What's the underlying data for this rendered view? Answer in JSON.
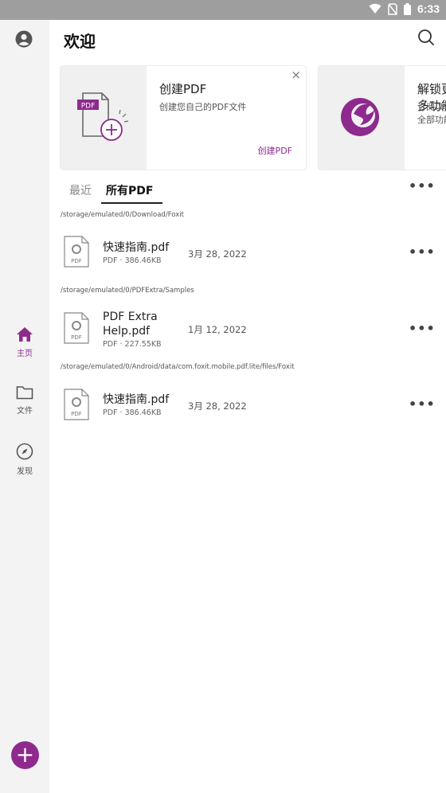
{
  "status_bar": {
    "time": "6:33"
  },
  "header": {
    "title": "欢迎"
  },
  "promo_cards": [
    {
      "title": "创建PDF",
      "description": "创建您自己的PDF文件",
      "action": "创建PDF",
      "icon_badge": "PDF",
      "close": "×"
    },
    {
      "title": "解锁更多功能",
      "description": "订阅以使用全部功能"
    }
  ],
  "tabs": [
    {
      "label": "最近"
    },
    {
      "label": "所有PDF"
    }
  ],
  "more_label": "•••",
  "files": [
    {
      "path": "/storage/emulated/0/Download/Foxit",
      "name": "快速指南.pdf",
      "type": "PDF",
      "size": "386.46KB",
      "date": "3月 28, 2022",
      "badge": "PDF"
    },
    {
      "path": "/storage/emulated/0/PDFExtra/Samples",
      "name_line1": "PDF Extra",
      "name_line2": "Help.pdf",
      "type": "PDF",
      "size": "227.55KB",
      "date": "1月 12, 2022",
      "badge": "PDF"
    },
    {
      "path": "/storage/emulated/0/Android/data/com.foxit.mobile.pdf.lite/files/Foxit",
      "name": "快速指南.pdf",
      "type": "PDF",
      "size": "386.46KB",
      "date": "3月 28, 2022",
      "badge": "PDF"
    }
  ],
  "nav": [
    {
      "label": "主页",
      "icon": "home-icon"
    },
    {
      "label": "文件",
      "icon": "folder-icon"
    },
    {
      "label": "发现",
      "icon": "compass-icon"
    }
  ],
  "fab": {
    "label": "+"
  },
  "colors": {
    "accent": "#8e2a8e",
    "rail": "#f3f3f3",
    "status_bar": "#9e9e9e"
  }
}
